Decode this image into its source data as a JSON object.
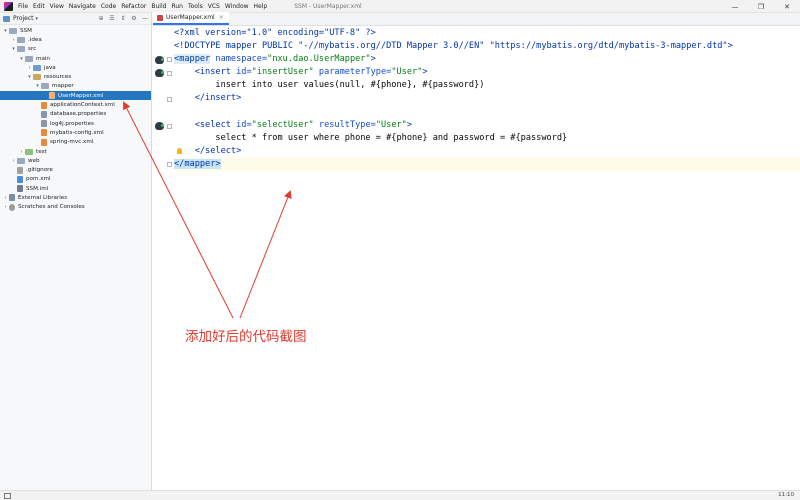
{
  "menubar": {
    "items": [
      "File",
      "Edit",
      "View",
      "Navigate",
      "Code",
      "Refactor",
      "Build",
      "Run",
      "Tools",
      "VCS",
      "Window",
      "Help"
    ],
    "window_title": "SSM - UserMapper.xml",
    "controls": [
      "—",
      "❐",
      "✕"
    ]
  },
  "project_panel": {
    "title": "Project",
    "caret": "▾",
    "tools": [
      "⊕",
      "☰",
      "⇕",
      "⚙",
      "—"
    ]
  },
  "tree": [
    {
      "label": "SSM",
      "arrow": "▾",
      "icon": "folder plain",
      "name": "project-root"
    },
    {
      "label": ".idea",
      "arrow": "›",
      "icon": "folder plain",
      "name": "idea-folder"
    },
    {
      "label": "src",
      "arrow": "▾",
      "icon": "folder plain",
      "name": "src-folder"
    },
    {
      "label": "main",
      "arrow": "▾",
      "icon": "folder plain",
      "name": "main-folder"
    },
    {
      "label": "java",
      "arrow": "›",
      "icon": "folder src",
      "name": "java-folder"
    },
    {
      "label": "resources",
      "arrow": "▾",
      "icon": "folder res",
      "name": "resources-folder"
    },
    {
      "label": "mapper",
      "arrow": "▾",
      "icon": "folder plain",
      "name": "mapper-folder"
    },
    {
      "label": "UserMapper.xml",
      "arrow": "",
      "icon": "file xml",
      "name": "usermapper-file",
      "selected": true
    },
    {
      "label": "applicationContext.xml",
      "arrow": "",
      "icon": "file xml",
      "name": "applicationcontext-file"
    },
    {
      "label": "database.properties",
      "arrow": "",
      "icon": "file props",
      "name": "database-properties-file"
    },
    {
      "label": "log4j.properties",
      "arrow": "",
      "icon": "file props",
      "name": "log4j-properties-file"
    },
    {
      "label": "mybatis-config.xml",
      "arrow": "",
      "icon": "file xml",
      "name": "mybatis-config-file"
    },
    {
      "label": "spring-mvc.xml",
      "arrow": "",
      "icon": "file xml",
      "name": "spring-mvc-file"
    },
    {
      "label": "test",
      "arrow": "›",
      "icon": "folder test",
      "name": "test-folder"
    },
    {
      "label": "web",
      "arrow": "›",
      "icon": "folder plain",
      "name": "web-folder"
    },
    {
      "label": ".gitignore",
      "arrow": "",
      "icon": "file git",
      "name": "gitignore-file"
    },
    {
      "label": "pom.xml",
      "arrow": "",
      "icon": "file pom",
      "name": "pom-file"
    },
    {
      "label": "SSM.iml",
      "arrow": "",
      "icon": "file iml",
      "name": "ssm-iml-file"
    },
    {
      "label": "External Libraries",
      "arrow": "›",
      "icon": "file lib",
      "name": "external-libraries"
    },
    {
      "label": "Scratches and Consoles",
      "arrow": "›",
      "icon": "file scratch",
      "name": "scratches-and-consoles"
    }
  ],
  "editor": {
    "tab_label": "UserMapper.xml",
    "tab_close": "×",
    "code": {
      "l1": "<?xml version=\"1.0\" encoding=\"UTF-8\" ?>",
      "l2": "<!DOCTYPE mapper PUBLIC \"-//mybatis.org//DTD Mapper 3.0//EN\" \"https://mybatis.org/dtd/mybatis-3-mapper.dtd\">",
      "l3_tag_open": "<",
      "l3_tag_name": "mapper",
      "l3_attr": " namespace=",
      "l3_val": "\"nxu.dao.UserMapper\"",
      "l3_close": ">",
      "l4_indent": "    ",
      "l4_tag": "<insert",
      "l4_attr1": " id=",
      "l4_val1": "\"insertUser\"",
      "l4_attr2": " parameterType=",
      "l4_val2": "\"User\"",
      "l4_close": ">",
      "l5": "        insert into user values(null, #{phone}, #{password})",
      "l6": "    </insert>",
      "l7": "",
      "l8_indent": "    ",
      "l8_tag": "<select",
      "l8_attr1": " id=",
      "l8_val1": "\"selectUser\"",
      "l8_attr2": " resultType=",
      "l8_val2": "\"User\"",
      "l8_close": ">",
      "l9": "        select * from user where phone = #{phone} and password = #{password}",
      "l10": "    </select>",
      "l11_open": "</",
      "l11_name": "mapper",
      "l11_close": ">"
    }
  },
  "annotation": {
    "text": "添加好后的代码截图",
    "color": "#e23b2e"
  },
  "statusbar": {
    "time": "11:10"
  },
  "colors": {
    "selection": "#2675bf",
    "tag": "#0033b3",
    "string": "#067d17",
    "current_line": "#fefbe7"
  }
}
